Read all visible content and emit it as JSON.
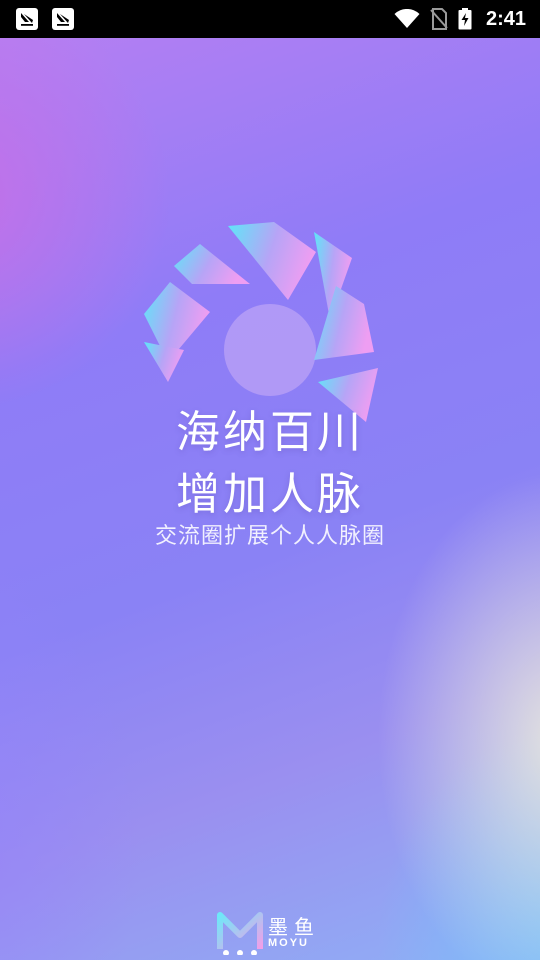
{
  "status_bar": {
    "time": "2:41",
    "left_icons": [
      "notification-icon",
      "notification-icon"
    ],
    "right_icons": [
      "wifi-icon",
      "no-sim-icon",
      "battery-charging-icon"
    ]
  },
  "splash": {
    "headline_line1": "海纳百川",
    "headline_line2": "增加人脉",
    "subline": "交流圈扩展个人人脉圈",
    "brand_name": "墨鱼",
    "brand_sub": "MOYU"
  },
  "colors": {
    "accent_cyan": "#5ee6f8",
    "accent_pink": "#e9a0f4",
    "bg_violet": "#8f7cf7"
  }
}
